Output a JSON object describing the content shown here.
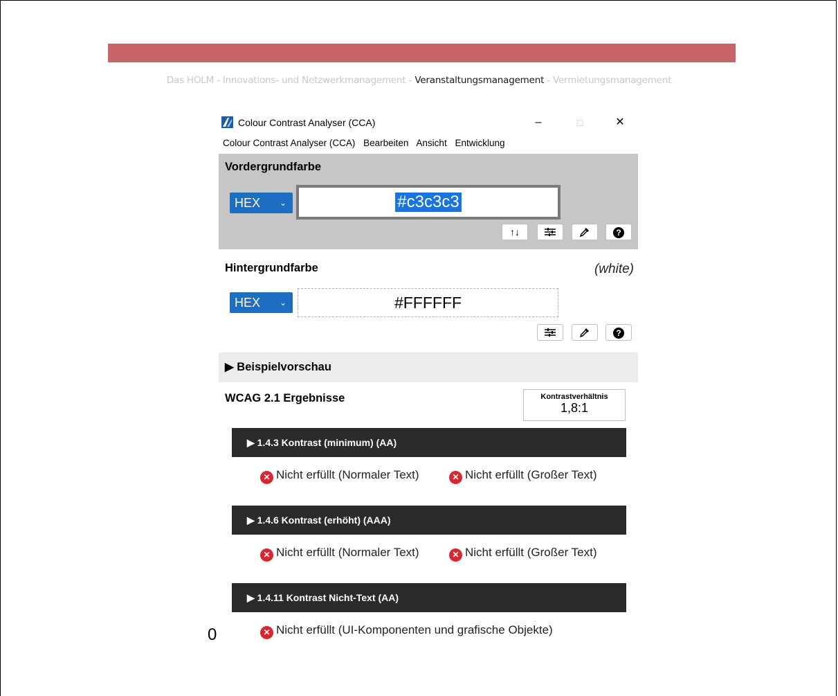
{
  "page": {
    "crumbs": [
      {
        "label": "Das HOLM - Innovations- und Netzwerkmanagement - "
      },
      {
        "label": "Veranstaltungsmanagement"
      },
      {
        "label": " - Vermietungsmanagement"
      }
    ],
    "stray_text": "0",
    "colors": {
      "banner": "#c9636a"
    }
  },
  "window": {
    "title": "Colour Contrast Analyser (CCA)",
    "controls": {
      "minimize": "–",
      "maximize": "□",
      "close": "✕"
    },
    "menu": [
      "Colour Contrast Analyser (CCA)",
      "Bearbeiten",
      "Ansicht",
      "Entwicklung"
    ]
  },
  "foreground": {
    "heading": "Vordergrundfarbe",
    "format": "HEX",
    "value": "#c3c3c3",
    "tools": [
      "swap-icon",
      "sliders-icon",
      "eyedropper-icon",
      "help-icon"
    ]
  },
  "background": {
    "heading": "Hintergrundfarbe",
    "color_name": "(white)",
    "format": "HEX",
    "value": "#FFFFFF",
    "tools": [
      "sliders-icon",
      "eyedropper-icon",
      "help-icon"
    ]
  },
  "preview": {
    "label": "Beispielvorschau"
  },
  "results": {
    "heading": "WCAG 2.1 Ergebnisse",
    "ratio_label": "Kontrastverhältnis",
    "ratio_value": "1,8:1",
    "criteria": [
      {
        "title": "1.4.3 Kontrast (minimum) (AA)",
        "left": "Nicht erfüllt (Normaler Text)",
        "right": "Nicht erfüllt (Großer Text)"
      },
      {
        "title": "1.4.6 Kontrast (erhöht) (AAA)",
        "left": "Nicht erfüllt (Normaler Text)",
        "right": "Nicht erfüllt (Großer Text)"
      },
      {
        "title": "1.4.11 Kontrast Nicht-Text (AA)",
        "single": "Nicht erfüllt (UI-Komponenten und grafische Objekte)"
      }
    ]
  }
}
